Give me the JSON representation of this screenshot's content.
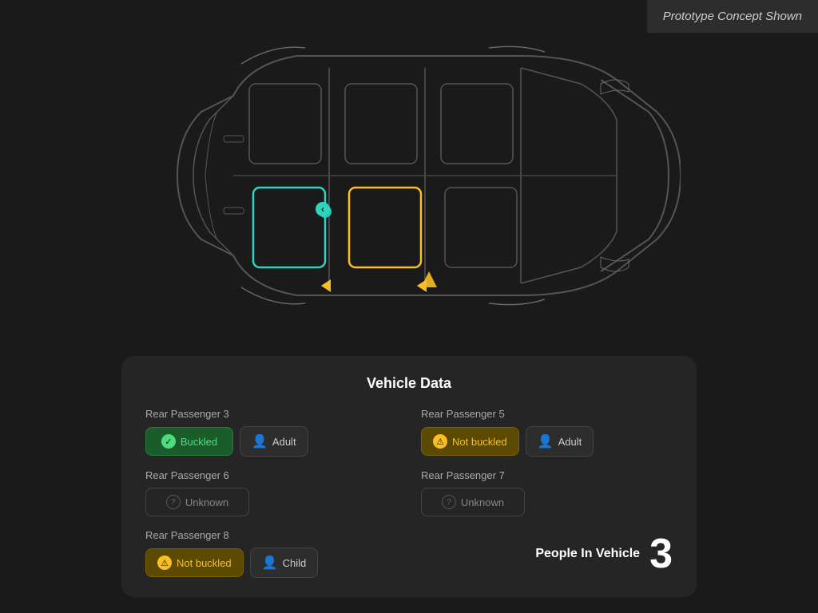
{
  "prototype": {
    "label": "Prototype Concept Shown"
  },
  "panel": {
    "title": "Vehicle Data",
    "passengers": [
      {
        "id": "passenger-3",
        "label": "Rear Passenger 3",
        "status": "buckled",
        "status_text": "Buckled",
        "type": "adult",
        "type_text": "Adult"
      },
      {
        "id": "passenger-5",
        "label": "Rear Passenger 5",
        "status": "not-buckled",
        "status_text": "Not buckled",
        "type": "adult",
        "type_text": "Adult"
      },
      {
        "id": "passenger-6",
        "label": "Rear Passenger 6",
        "status": "unknown",
        "status_text": "Unknown",
        "type": null
      },
      {
        "id": "passenger-7",
        "label": "Rear Passenger 7",
        "status": "unknown",
        "status_text": "Unknown",
        "type": null
      }
    ],
    "passenger_8": {
      "label": "Rear Passenger 8",
      "status": "not-buckled",
      "status_text": "Not buckled",
      "type": "child",
      "type_text": "Child"
    },
    "people_in_vehicle": {
      "label": "People In Vehicle",
      "count": "3"
    }
  }
}
